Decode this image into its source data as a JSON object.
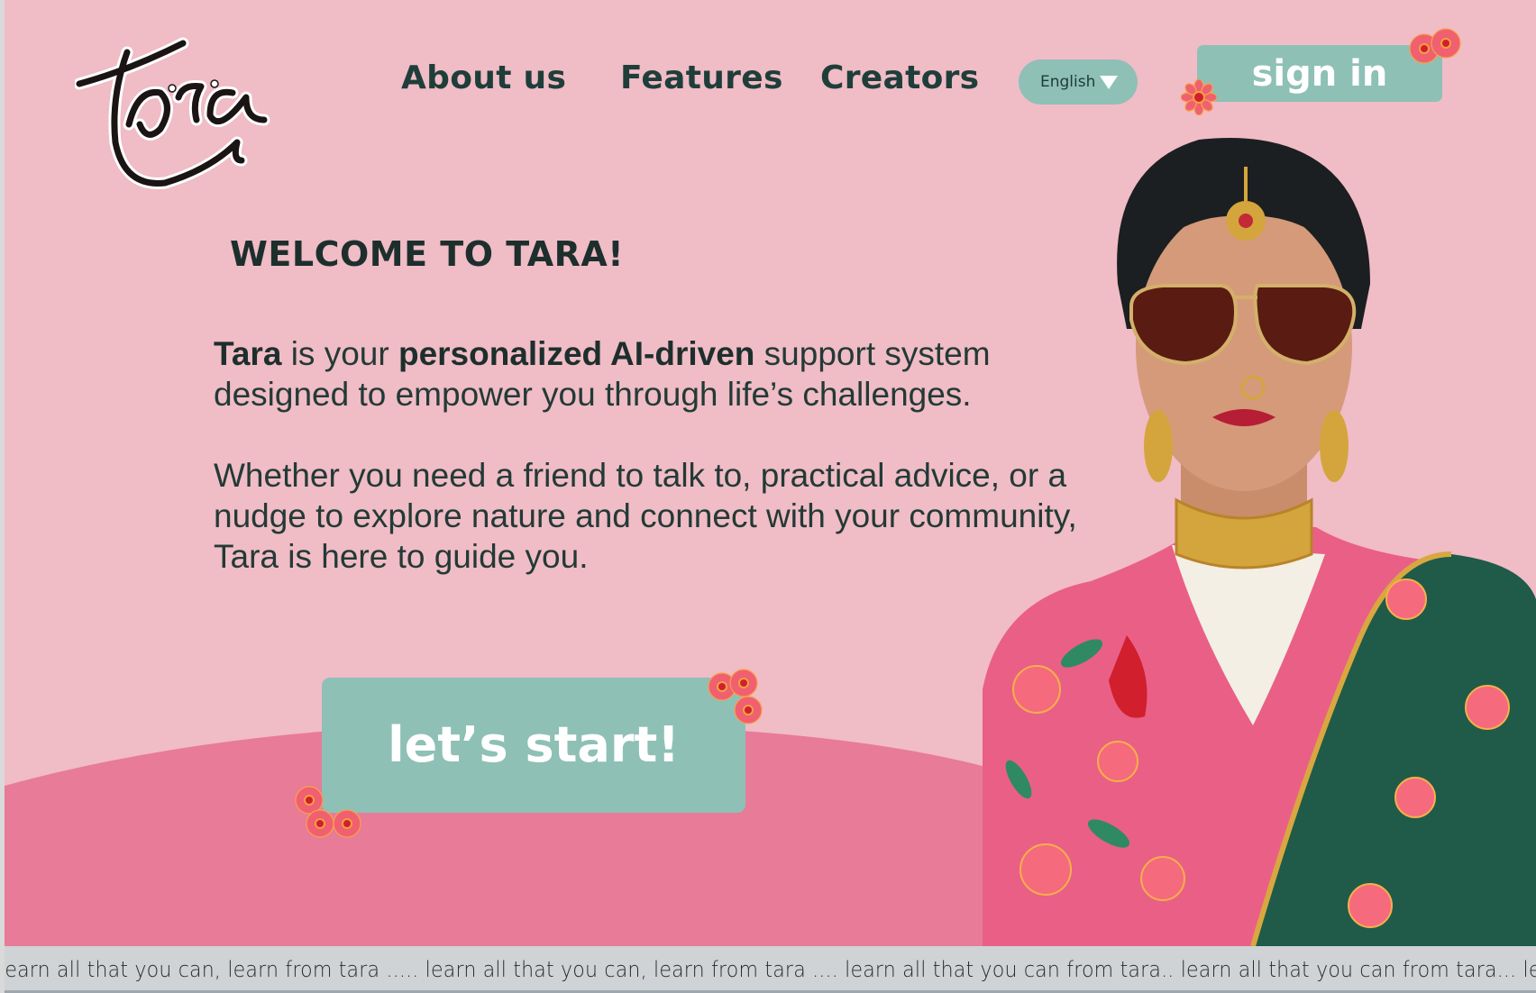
{
  "brand": {
    "logo_text": "tara"
  },
  "nav": {
    "about": "About us",
    "features": "Features",
    "creators": "Creators",
    "language": "English",
    "sign_in": "sign in"
  },
  "hero": {
    "welcome": "WELCOME TO TARA!",
    "intro": {
      "b1": "Tara",
      "t1": " is your ",
      "b2": "personalized AI-driven",
      "t2": " support system designed to empower you through life’s challenges."
    },
    "paragraph2": " Whether you need a friend to talk to, practical advice, or a nudge to explore nature and connect with your community, Tara is here to guide you.",
    "cta": "let’s start!"
  },
  "ticker": {
    "text": "learn all that you can, learn from tara  ..... learn all that you can, learn from tara .... learn all that you can from tara.. learn all that you can from tara... learn all that you can"
  },
  "colors": {
    "background": "#f0bcc6",
    "hill": "#e87b97",
    "accent": "#8ec0b6",
    "text_dark": "#1f3e3a"
  },
  "icons": [
    "dropdown-caret-icon",
    "flower-icon"
  ]
}
